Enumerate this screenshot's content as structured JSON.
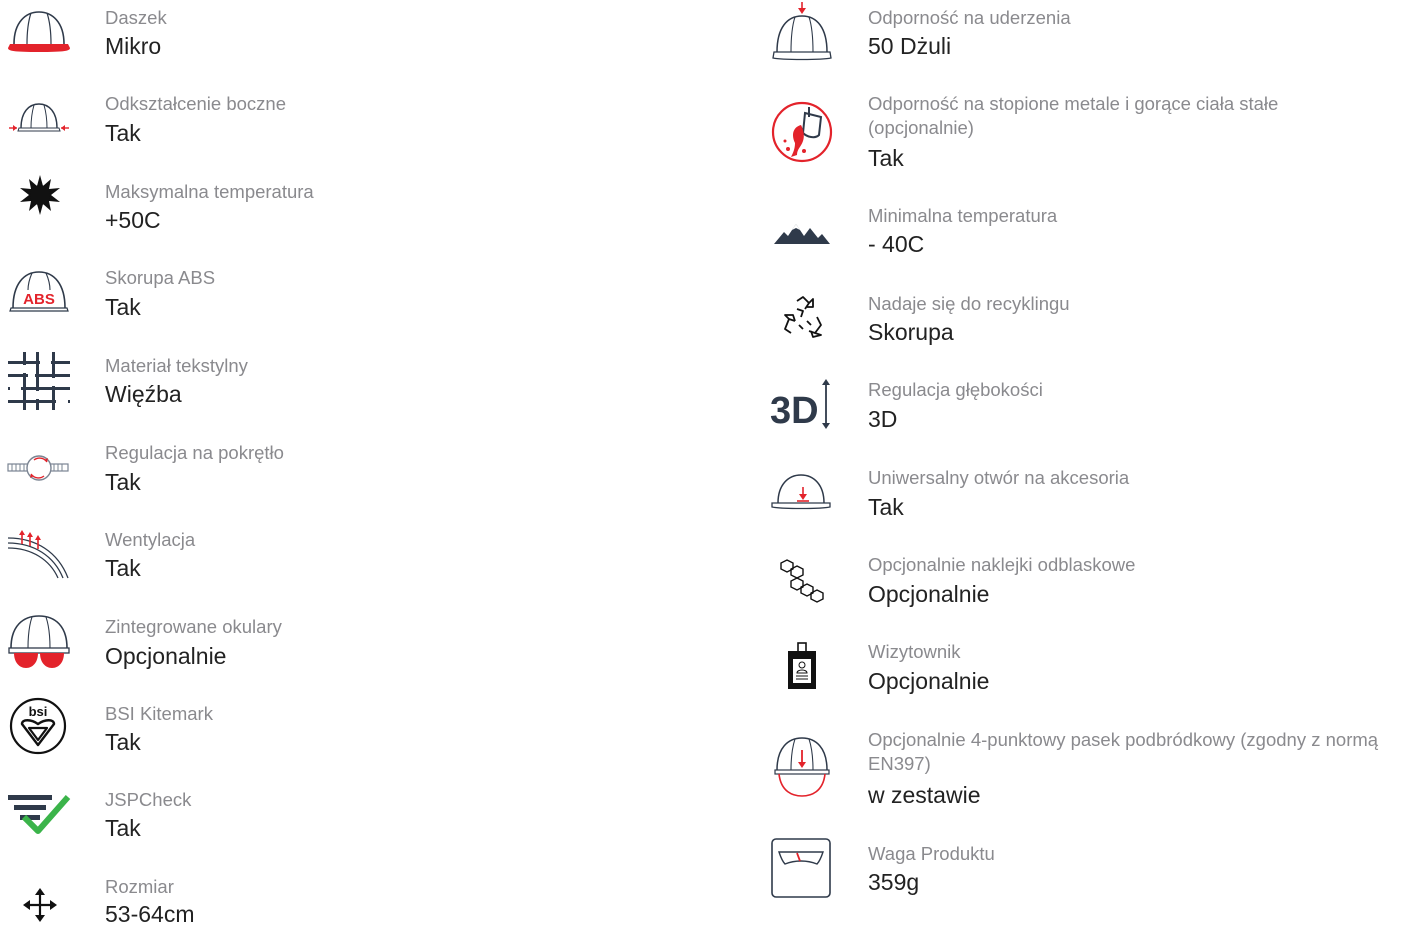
{
  "colors": {
    "accent": "#e3232b",
    "dark": "#2f3a4a",
    "check": "#3bb44a",
    "label": "#8a8a8e",
    "value": "#222222"
  },
  "left": [
    {
      "icon": "helmet-peak-icon",
      "label": "Daszek",
      "value": "Mikro"
    },
    {
      "icon": "side-deformation-icon",
      "label": "Odkształcenie boczne",
      "value": "Tak"
    },
    {
      "icon": "sun-icon",
      "label": "Maksymalna temperatura",
      "value": "+50C"
    },
    {
      "icon": "abs-shell-icon",
      "label": "Skorupa ABS",
      "icon_text": "ABS",
      "value": "Tak"
    },
    {
      "icon": "textile-icon",
      "label": "Materiał tekstylny",
      "value": "Więźba"
    },
    {
      "icon": "wheel-ratchet-icon",
      "label": "Regulacja na pokrętło",
      "value": "Tak"
    },
    {
      "icon": "ventilation-icon",
      "label": "Wentylacja",
      "value": "Tak"
    },
    {
      "icon": "integrated-glasses-icon",
      "label": "Zintegrowane okulary",
      "value": "Opcjonalnie"
    },
    {
      "icon": "bsi-kitemark-icon",
      "label": "BSI Kitemark",
      "icon_text": "bsi",
      "value": "Tak"
    },
    {
      "icon": "jspcheck-icon",
      "label": "JSPCheck",
      "value": "Tak"
    },
    {
      "icon": "size-arrows-icon",
      "label": "Rozmiar",
      "value": "53-64cm"
    }
  ],
  "right": [
    {
      "icon": "impact-icon",
      "label": "Odporność na uderzenia",
      "value": "50 Dżuli"
    },
    {
      "icon": "molten-metal-icon",
      "label": "Odporność na stopione metale i gorące ciała stałe (opcjonalnie)",
      "value": "Tak"
    },
    {
      "icon": "mountains-icon",
      "label": "Minimalna temperatura",
      "value": "- 40C"
    },
    {
      "icon": "recycle-icon",
      "label": "Nadaje się do recyklingu",
      "value": "Skorupa"
    },
    {
      "icon": "3d-adjust-icon",
      "label": "Regulacja głębokości",
      "icon_text": "3D",
      "value": "3D"
    },
    {
      "icon": "accessory-slot-icon",
      "label": "Uniwersalny otwór na akcesoria",
      "value": "Tak"
    },
    {
      "icon": "reflective-stickers-icon",
      "label": "Opcjonalnie naklejki odblaskowe",
      "value": "Opcjonalnie"
    },
    {
      "icon": "card-holder-icon",
      "label": "Wizytownik",
      "value": "Opcjonalnie"
    },
    {
      "icon": "chinstrap-icon",
      "label": "Opcjonalnie 4-punktowy pasek podbródkowy (zgodny z normą EN397)",
      "value": "w zestawie"
    },
    {
      "icon": "scale-icon",
      "label": "Waga Produktu",
      "value": "359g"
    }
  ]
}
